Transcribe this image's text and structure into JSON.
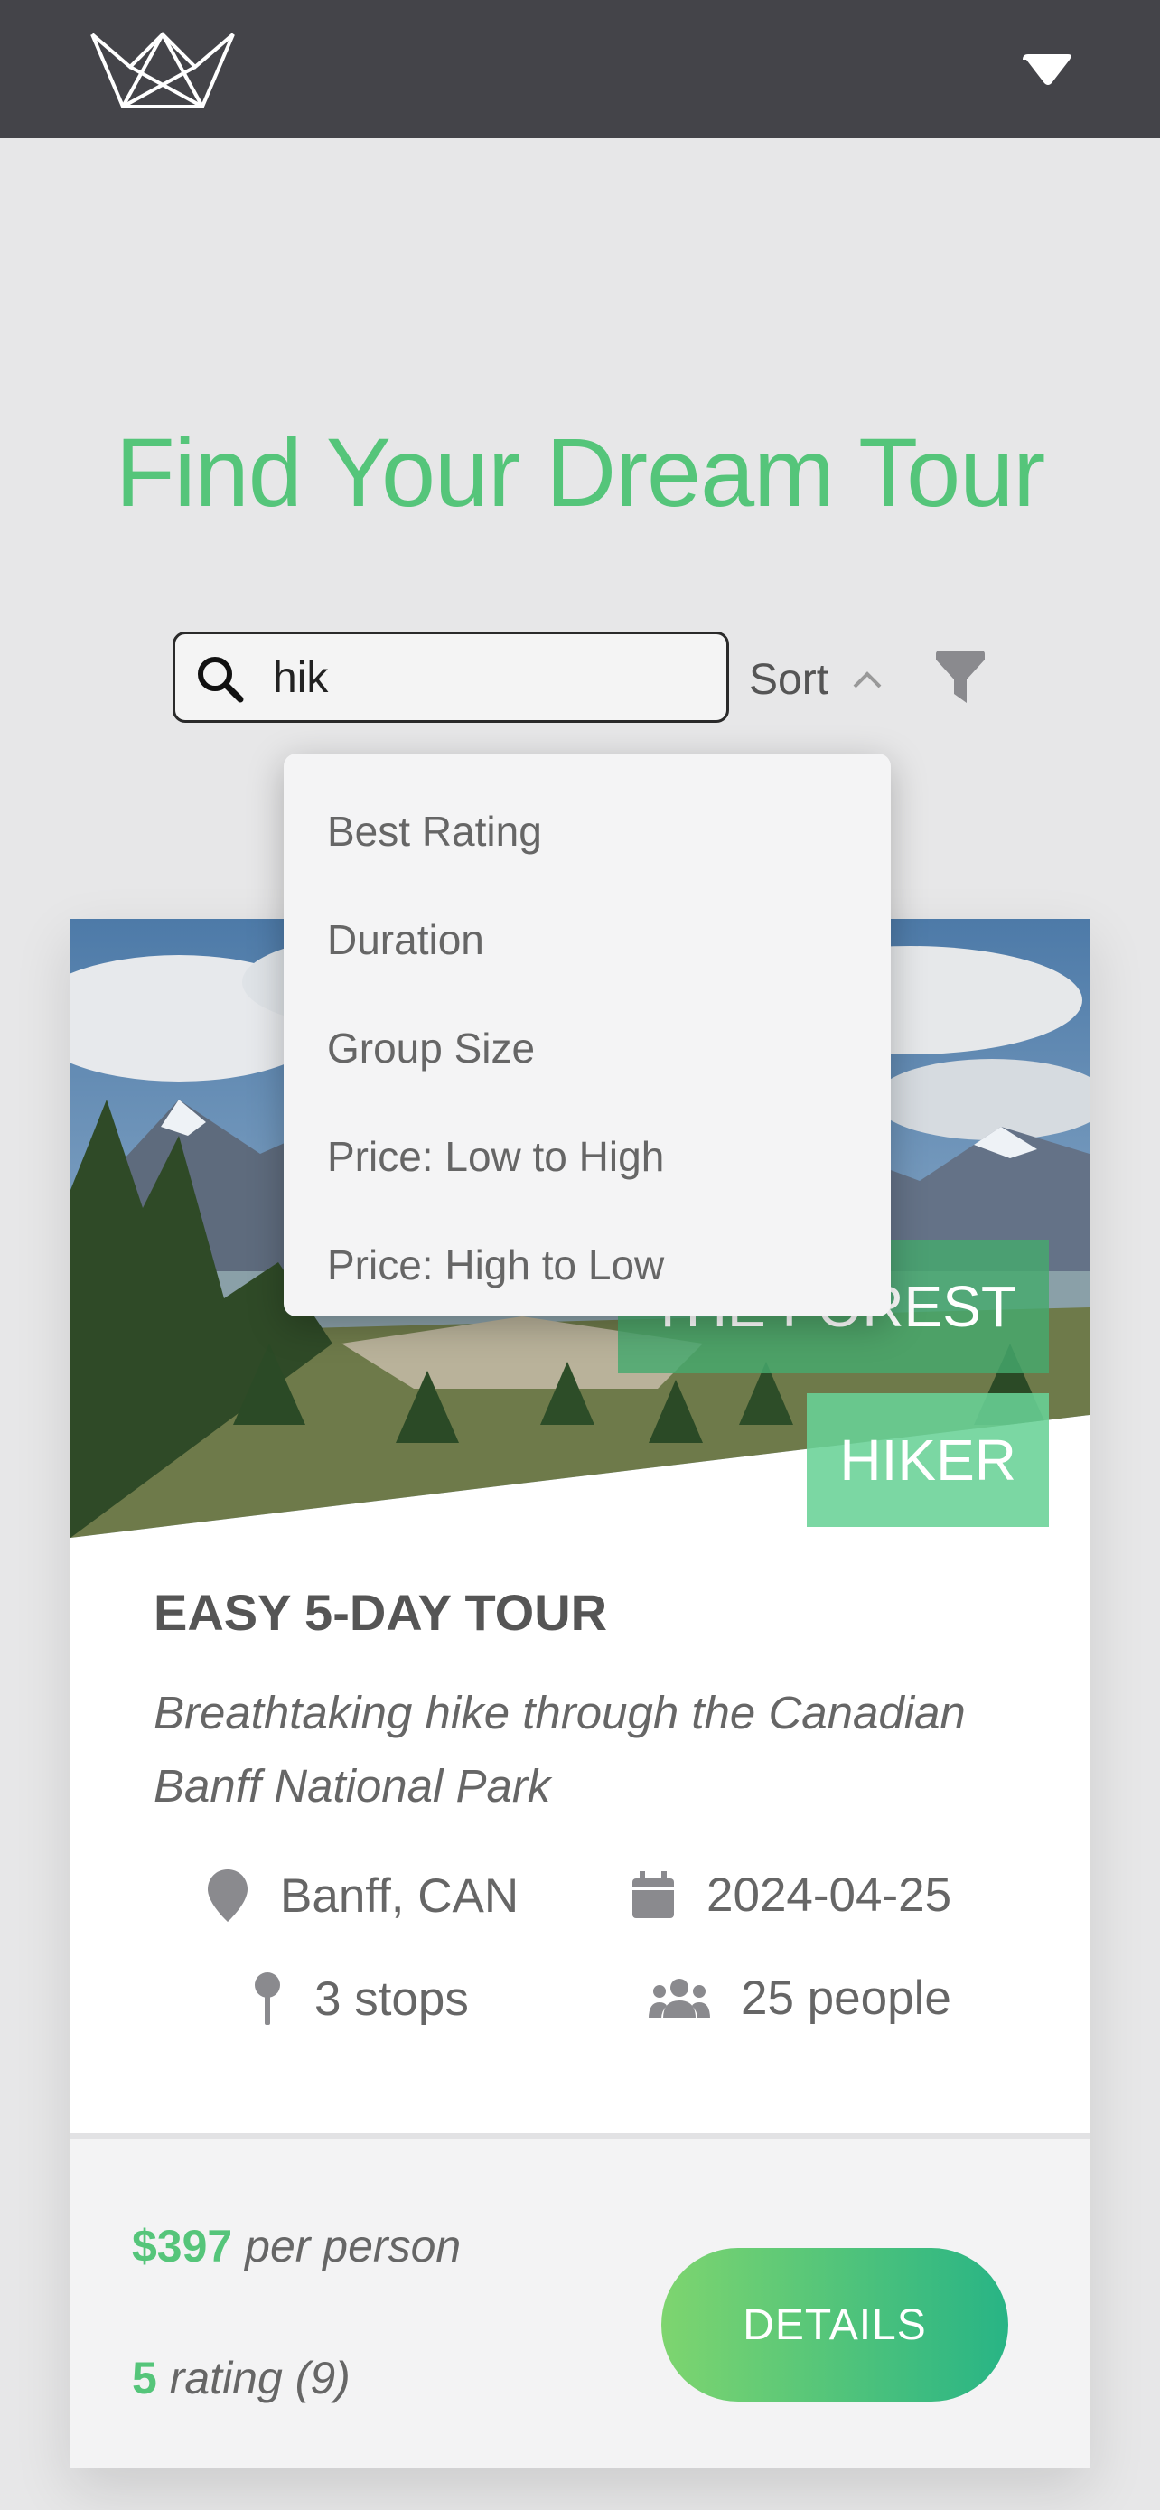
{
  "header": {
    "logo_icon": "crown-logo-icon",
    "menu_icon": "chevron-down-icon"
  },
  "page": {
    "title": "Find Your Dream Tour"
  },
  "search": {
    "value": "hik",
    "icon": "search-icon"
  },
  "sort": {
    "label": "Sort",
    "icon": "chevron-up-icon",
    "options": [
      "Best Rating",
      "Duration",
      "Group Size",
      "Price: Low to High",
      "Price: High to Low"
    ]
  },
  "filter": {
    "icon": "filter-icon"
  },
  "tour": {
    "tag_line1": "THE FOREST",
    "tag_line2": "HIKER",
    "title": "EASY 5-DAY TOUR",
    "description": "Breathtaking hike through the Canadian Banff National Park",
    "location": "Banff, CAN",
    "date": "2024-04-25",
    "stops": "3 stops",
    "group": "25 people",
    "price": "$397",
    "price_suffix": "per person",
    "rating": "5",
    "rating_suffix": "rating (9)",
    "button_label": "DETAILS"
  },
  "colors": {
    "accent": "#55c57a",
    "header_bg": "#444449",
    "page_bg": "#e7e7e8"
  }
}
